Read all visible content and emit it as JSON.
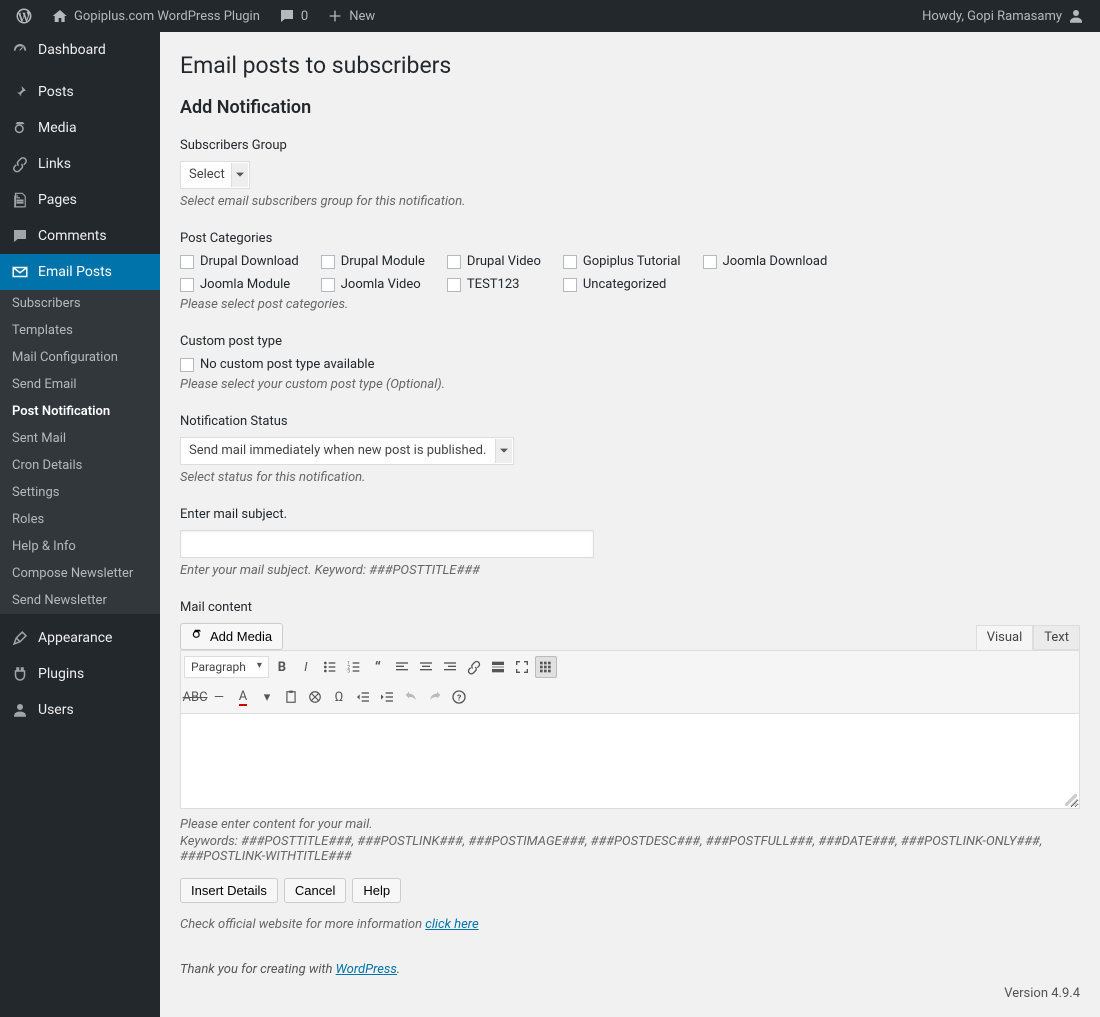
{
  "adminbar": {
    "site_title": "Gopiplus.com WordPress Plugin",
    "comments_count": "0",
    "new_label": "New",
    "howdy": "Howdy, Gopi Ramasamy"
  },
  "menu": {
    "items": [
      {
        "label": "Dashboard",
        "icon": "dashboard"
      },
      {
        "label": "Posts",
        "icon": "pin"
      },
      {
        "label": "Media",
        "icon": "media"
      },
      {
        "label": "Links",
        "icon": "link"
      },
      {
        "label": "Pages",
        "icon": "page"
      },
      {
        "label": "Comments",
        "icon": "comment"
      },
      {
        "label": "Email Posts",
        "icon": "email"
      },
      {
        "label": "Appearance",
        "icon": "appearance"
      },
      {
        "label": "Plugins",
        "icon": "plugin"
      },
      {
        "label": "Users",
        "icon": "user"
      }
    ],
    "active": "Email Posts",
    "submenu": [
      "Subscribers",
      "Templates",
      "Mail Configuration",
      "Send Email",
      "Post Notification",
      "Sent Mail",
      "Cron Details",
      "Settings",
      "Roles",
      "Help & Info",
      "Compose Newsletter",
      "Send Newsletter"
    ],
    "submenu_active": "Post Notification"
  },
  "page": {
    "title": "Email posts to subscribers",
    "subtitle": "Add Notification",
    "subscribers_group_label": "Subscribers Group",
    "subscribers_group_value": "Select",
    "subscribers_group_desc": "Select email subscribers group for this notification.",
    "post_categories_label": "Post Categories",
    "categories": [
      "Drupal Download",
      "Drupal Module",
      "Drupal Video",
      "Gopiplus Tutorial",
      "Joomla Download",
      "Joomla Module",
      "Joomla Video",
      "TEST123",
      "Uncategorized"
    ],
    "post_categories_desc": "Please select post categories.",
    "custom_post_type_label": "Custom post type",
    "custom_post_type_option": "No custom post type available",
    "custom_post_type_desc": "Please select your custom post type (Optional).",
    "notif_status_label": "Notification Status",
    "notif_status_value": "Send mail immediately when new post is published.",
    "notif_status_desc": "Select status for this notification.",
    "mail_subject_label": "Enter mail subject.",
    "mail_subject_desc": "Enter your mail subject. Keyword: ###POSTTITLE###",
    "mail_content_label": "Mail content",
    "add_media_label": "Add Media",
    "visual_tab": "Visual",
    "text_tab": "Text",
    "format_select": "Paragraph",
    "mail_content_desc1": "Please enter content for your mail.",
    "mail_content_desc2": "Keywords: ###POSTTITLE###, ###POSTLINK###, ###POSTIMAGE###, ###POSTDESC###, ###POSTFULL###, ###DATE###, ###POSTLINK-ONLY###, ###POSTLINK-WITHTITLE###",
    "btn_insert": "Insert Details",
    "btn_cancel": "Cancel",
    "btn_help": "Help",
    "official_msg_prefix": "Check official website for more information ",
    "official_link": "click here",
    "thank_you_prefix": "Thank you for creating with ",
    "thank_you_link": "WordPress",
    "thank_you_suffix": ".",
    "version": "Version 4.9.4"
  }
}
